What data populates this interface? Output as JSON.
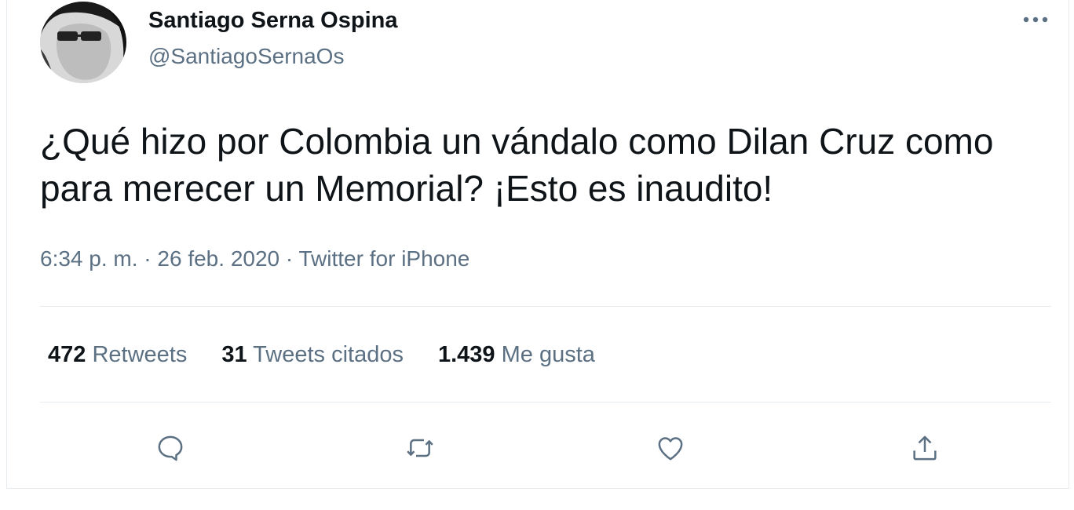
{
  "tweet": {
    "author_name": "Santiago Serna Ospina",
    "author_handle": "@SantiagoSernaOs",
    "text": "¿Qué hizo por Colombia un vándalo como Dilan Cruz como para merecer un Memorial? ¡Esto es inaudito!",
    "time": "6:34 p. m.",
    "date": "26 feb. 2020",
    "source": "Twitter for iPhone",
    "separator": "·"
  },
  "stats": {
    "retweets_count": "472",
    "retweets_label": "Retweets",
    "quotes_count": "31",
    "quotes_label": "Tweets citados",
    "likes_count": "1.439",
    "likes_label": "Me gusta"
  },
  "icons": {
    "more": "more-horizontal-icon",
    "reply": "reply-icon",
    "retweet": "retweet-icon",
    "like": "heart-icon",
    "share": "share-icon"
  },
  "colors": {
    "text_primary": "#0f1419",
    "text_secondary": "#5b7083",
    "divider": "#e6ecf0"
  }
}
